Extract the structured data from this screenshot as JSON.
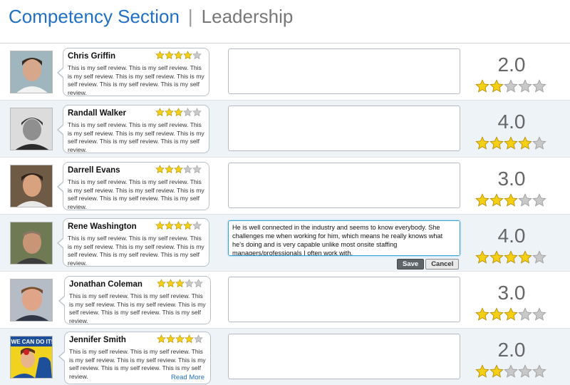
{
  "header": {
    "section": "Competency Section",
    "separator": "|",
    "subsection": "Leadership"
  },
  "star_colors": {
    "filled": "#f5cf14",
    "filled_stroke": "#b08a00",
    "empty": "#c8c8c8",
    "empty_stroke": "#9a9a9a"
  },
  "rows": [
    {
      "name": "Chris Griffin",
      "self_rating": 4,
      "review": "This is my self review. This is my self review. This is my self review. This is my self review. This is my self review. This is my self review. This is my self review.",
      "comment": "",
      "score": "2.0",
      "manager_rating": 2,
      "avatar": "person-photo"
    },
    {
      "name": "Randall Walker",
      "self_rating": 3,
      "review": "This is my self review. This is my self review. This is my self review. This is my self review. This is my self review. This is my self review. This is my self review.",
      "comment": "",
      "score": "4.0",
      "manager_rating": 4,
      "avatar": "person-photo-beanie"
    },
    {
      "name": "Darrell Evans",
      "self_rating": 3,
      "review": "This is my self review. This is my self review. This is my self review. This is my self review. This is my self review. This is my self review. This is my self review.",
      "comment": "",
      "score": "3.0",
      "manager_rating": 3,
      "avatar": "person-photo"
    },
    {
      "name": "Rene Washington",
      "self_rating": 4,
      "review": "This is my self review. This is my self review. This is my self review. This is my self review. This is my self review. This is my self review. This is my self review.",
      "comment": "He is well connected in the industry and seems to know everybody. She challenges me when working for him, which means he really knows what he's doing and is very capable unlike most onsite staffing managers/professionals I often work with.",
      "score": "4.0",
      "manager_rating": 4,
      "avatar": "person-photo"
    },
    {
      "name": "Jonathan Coleman",
      "self_rating": 3,
      "review": "This is my self review. This is my self review. This is my self review. This is my self review. This is my self review. This is my self review. This is my self review.",
      "comment": "",
      "score": "3.0",
      "manager_rating": 3,
      "avatar": "person-photo"
    },
    {
      "name": "Jennifer Smith",
      "self_rating": 4,
      "review": "This is my self review. This is my self review. This is my self review. This is my self review. This is my self review. This is my self review. This is my self review.",
      "comment": "",
      "score": "2.0",
      "manager_rating": 2,
      "avatar": "poster-we-can-do-it"
    }
  ],
  "editor": {
    "save_label": "Save",
    "cancel_label": "Cancel"
  },
  "read_more_label": "Read More"
}
